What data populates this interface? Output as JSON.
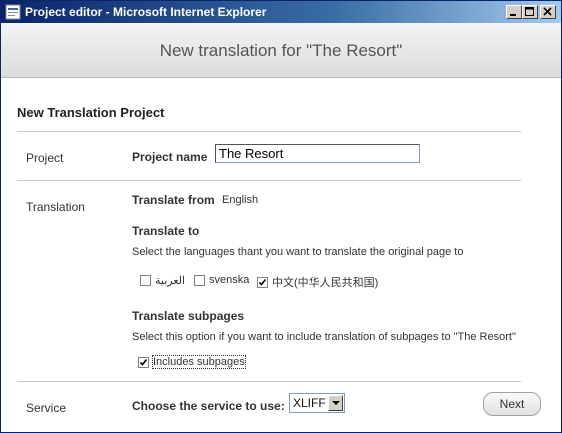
{
  "window": {
    "title": "Project editor - Microsoft Internet Explorer"
  },
  "header": {
    "title": "New translation for \"The Resort\""
  },
  "form": {
    "section_title": "New Translation Project",
    "project": {
      "row_label": "Project",
      "name_label": "Project name",
      "name_value": "The Resort"
    },
    "translation": {
      "row_label": "Translation",
      "from_label": "Translate from",
      "from_value": "English",
      "to_label": "Translate to",
      "to_help": "Select the languages thant you want to translate the original page to",
      "languages": [
        {
          "label": "العربية",
          "checked": false
        },
        {
          "label": "svenska",
          "checked": false
        },
        {
          "label": "中文(中华人民共和国)",
          "checked": true
        }
      ],
      "subpages_label": "Translate subpages",
      "subpages_help": "Select this option if you want to include translation of subpages to \"The Resort\"",
      "subpages_checkbox_label": "Includes subpages",
      "subpages_checked": true
    },
    "service": {
      "row_label": "Service",
      "choose_label": "Choose the service to use:",
      "selected": "XLIFF"
    },
    "next_button": "Next"
  }
}
